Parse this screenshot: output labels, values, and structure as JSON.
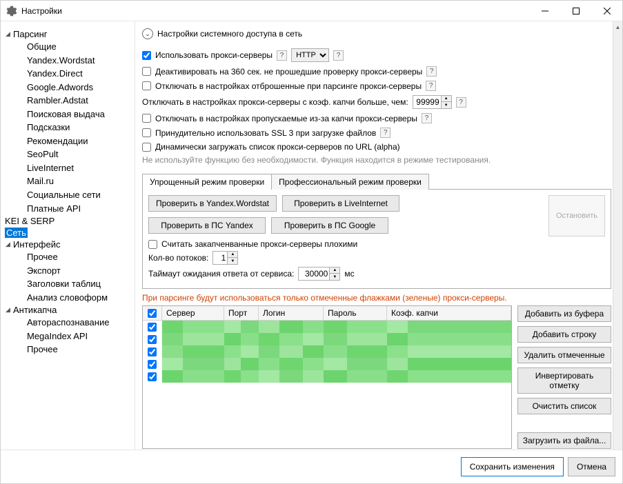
{
  "window": {
    "title": "Настройки"
  },
  "tree": {
    "groups": [
      {
        "label": "Парсинг",
        "expanded": true,
        "children": [
          "Общие",
          "Yandex.Wordstat",
          "Yandex.Direct",
          "Google.Adwords",
          "Rambler.Adstat",
          "Поисковая выдача",
          "Подсказки",
          "Рекомендации",
          "SeoPult",
          "LiveInternet",
          "Mail.ru",
          "Социальные сети",
          "Платные API"
        ]
      },
      {
        "label": "KEI & SERP",
        "top": true
      },
      {
        "label": "Сеть",
        "top": true,
        "selected": true
      },
      {
        "label": "Интерфейс",
        "expanded": true,
        "children": [
          "Прочее",
          "Экспорт",
          "Заголовки таблиц",
          "Анализ словоформ"
        ]
      },
      {
        "label": "Антикапча",
        "expanded": true,
        "children": [
          "Автораспознавание",
          "MegaIndex API",
          "Прочее"
        ]
      }
    ]
  },
  "section": {
    "title": "Настройки системного доступа в сеть"
  },
  "opts": {
    "use_proxy": "Использовать прокси-серверы",
    "protocol": "HTTP",
    "deactivate360": "Деактивировать на 360 сек. не прошедшие проверку прокси-серверы",
    "disable_rejected": "Отключать в настройках отброшенные при парсинге прокси-серверы",
    "disable_captcha_coef": "Отключать в настройках прокси-серверы с коэф. капчи больше, чем:",
    "coef_value": "99999",
    "disable_skipped": "Отключать в настройках пропускаемые из-за капчи прокси-серверы",
    "force_ssl3": "Принудительно использовать SSL 3 при загрузке файлов",
    "dynamic_url": "Динамически загружать список прокси-серверов по URL (alpha)",
    "alpha_note": "Не используйте функцию без необходимости. Функция находится в режиме тестирования."
  },
  "tabs": {
    "simple": "Упрощенный режим проверки",
    "pro": "Профессиональный режим проверки"
  },
  "check": {
    "yandex_wordstat": "Проверить в Yandex.Wordstat",
    "liveinternet": "Проверить в LiveInternet",
    "ps_yandex": "Проверить в ПС Yandex",
    "ps_google": "Проверить в ПС Google",
    "stop": "Остановить",
    "bad_captcha": "Считать закапченванные прокси-серверы плохими",
    "threads_label": "Кол-во потоков:",
    "threads_value": "1",
    "timeout_label": "Таймаут ожидания ответа от сервиса:",
    "timeout_value": "30000",
    "timeout_unit": "мс"
  },
  "red_note": "При парсинге будут использоваться только отмеченные флажками (зеленые) прокси-серверы.",
  "grid": {
    "headers": {
      "server": "Сервер",
      "port": "Порт",
      "login": "Логин",
      "password": "Пароль",
      "captcha": "Коэф. капчи"
    },
    "rows": 5
  },
  "grid_buttons": {
    "add_buffer": "Добавить из буфера",
    "add_row": "Добавить строку",
    "delete_checked": "Удалить отмеченные",
    "invert": "Инвертировать отметку",
    "clear": "Очистить список",
    "load_file": "Загрузить из файла..."
  },
  "footer": {
    "save": "Сохранить изменения",
    "cancel": "Отмена"
  }
}
